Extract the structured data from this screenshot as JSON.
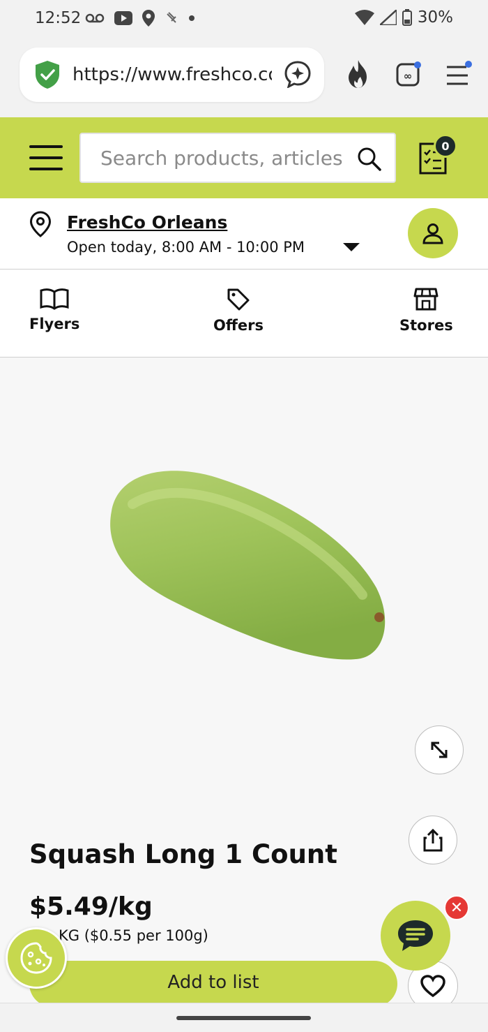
{
  "status_bar": {
    "time": "12:52",
    "battery": "30%",
    "icons_left": [
      "voicemail-icon",
      "youtube-icon",
      "location-icon",
      "accessibility-icon",
      "dot-icon"
    ],
    "icons_right": [
      "wifi-icon",
      "signal-icon",
      "battery-icon"
    ]
  },
  "browser": {
    "url": "https://www.freshco.com",
    "buttons": [
      "ai-assistant-icon",
      "fire-icon",
      "tab-switcher-icon",
      "browser-menu-icon"
    ]
  },
  "header": {
    "search_placeholder": "Search products, articles",
    "cart_count": "0",
    "brand_color": "#c6d84e"
  },
  "store": {
    "name": "FreshCo Orleans",
    "hours": "Open today, 8:00 AM - 10:00 PM"
  },
  "nav": {
    "items": [
      {
        "label": "Flyers",
        "icon": "book-icon"
      },
      {
        "label": "Offers",
        "icon": "tag-icon"
      },
      {
        "label": "Stores",
        "icon": "storefront-icon"
      }
    ]
  },
  "product": {
    "title": "Squash Long 1 Count",
    "price": "$5.49/kg",
    "unit_price": "KG ($0.55 per 100g)",
    "add_label": "Add to list"
  },
  "widgets": {
    "chat_close": "✕"
  }
}
